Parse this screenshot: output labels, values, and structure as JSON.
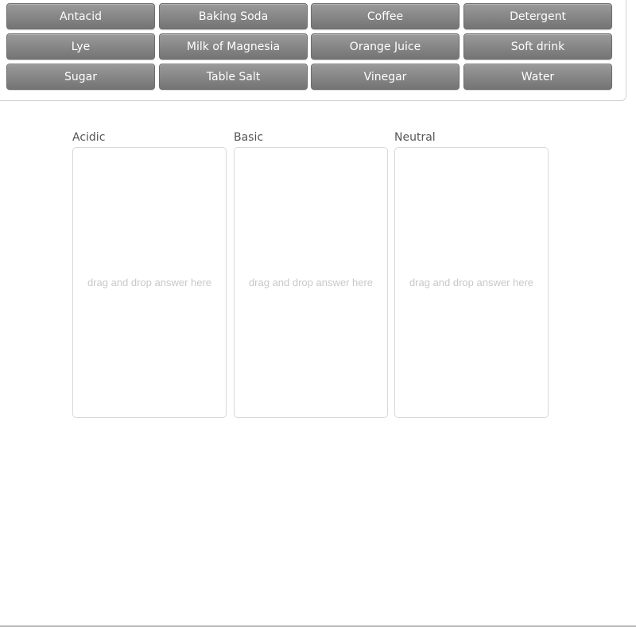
{
  "answer_bank": {
    "items": [
      {
        "label": "Antacid"
      },
      {
        "label": "Baking Soda"
      },
      {
        "label": "Coffee"
      },
      {
        "label": "Detergent"
      },
      {
        "label": "Lye"
      },
      {
        "label": "Milk of Magnesia"
      },
      {
        "label": "Orange Juice"
      },
      {
        "label": "Soft drink"
      },
      {
        "label": "Sugar"
      },
      {
        "label": "Table Salt"
      },
      {
        "label": "Vinegar"
      },
      {
        "label": "Water"
      }
    ]
  },
  "categories": [
    {
      "label": "Acidic",
      "placeholder": "drag and drop answer here"
    },
    {
      "label": "Basic",
      "placeholder": "drag and drop answer here"
    },
    {
      "label": "Neutral",
      "placeholder": "drag and drop answer here"
    }
  ]
}
